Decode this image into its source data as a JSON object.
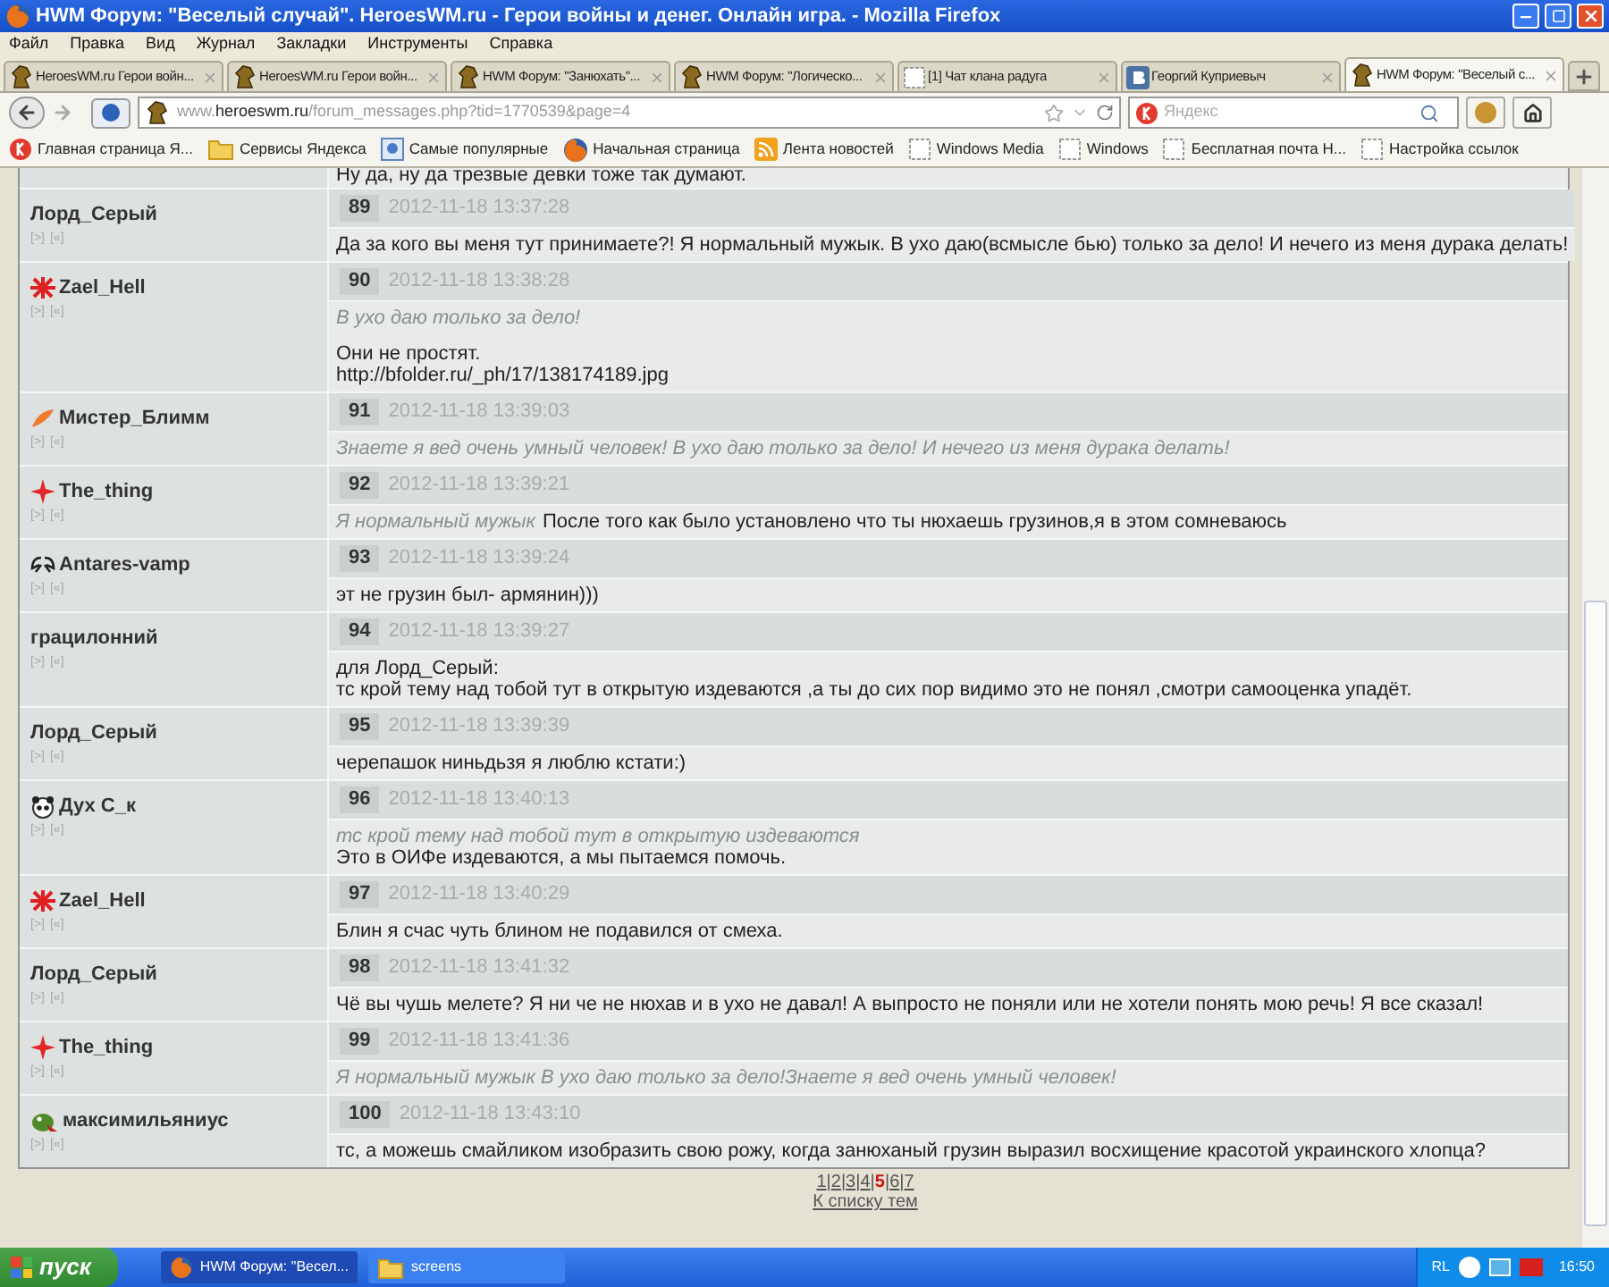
{
  "window": {
    "title": "HWM Форум: \"Веселый случай\". HeroesWM.ru - Герои войны и денег. Онлайн игра. - Mozilla Firefox"
  },
  "menu": [
    "Файл",
    "Правка",
    "Вид",
    "Журнал",
    "Закладки",
    "Инструменты",
    "Справка"
  ],
  "tabs": [
    {
      "label": "HeroesWM.ru Герои войн...",
      "kind": "knight",
      "selected": false
    },
    {
      "label": "HeroesWM.ru Герои войн...",
      "kind": "knight",
      "selected": false
    },
    {
      "label": "HWM Форум: \"Занюхать\"...",
      "kind": "knight",
      "selected": false
    },
    {
      "label": "HWM Форум: \"Логическо...",
      "kind": "knight",
      "selected": false
    },
    {
      "label": "[1] Чат клана радуга",
      "kind": "blank",
      "selected": false
    },
    {
      "label": "Георгий Куприевыч",
      "kind": "vk",
      "selected": false
    },
    {
      "label": "HWM Форум: \"Веселый с...",
      "kind": "knight",
      "selected": true
    }
  ],
  "address": {
    "prefix": "www.",
    "host": "heroeswm.ru",
    "path": "/forum_messages.php?tid=1770539&page=4"
  },
  "search": {
    "placeholder": "Яндекс"
  },
  "bookmarks": [
    {
      "label": "Главная страница Я...",
      "kind": "yandex"
    },
    {
      "label": "Сервисы Яндекса",
      "kind": "folder"
    },
    {
      "label": "Самые популярные",
      "kind": "popular"
    },
    {
      "label": "Начальная страница",
      "kind": "firefox"
    },
    {
      "label": "Лента новостей",
      "kind": "rss"
    },
    {
      "label": "Windows Media",
      "kind": "page"
    },
    {
      "label": "Windows",
      "kind": "page"
    },
    {
      "label": "Бесплатная почта Н...",
      "kind": "page"
    },
    {
      "label": "Настройка ссылок",
      "kind": "page"
    }
  ],
  "partial_text": "Ну да, ну да трезвые девки тоже так думают.",
  "posts": [
    {
      "author": "Лорд_Серый",
      "kind": "none",
      "links": [
        "[>]",
        "[«]"
      ],
      "number": "89",
      "date": "2012-11-18 13:37:28",
      "lines": [
        {
          "kind": "text",
          "text": "Да за кого вы меня тут принимаете?! Я нормальный мужык. В ухо даю(всмысле бью) только за дело! И нечего из меня дурака делать!"
        }
      ]
    },
    {
      "author": "Zael_Hell",
      "kind": "cross",
      "links": [
        "[>]",
        "[«]"
      ],
      "number": "90",
      "date": "2012-11-18 13:38:28",
      "lines": [
        {
          "kind": "quote",
          "text": "В ухо даю только за дело!"
        },
        {
          "kind": "break"
        },
        {
          "kind": "text",
          "text": "Они не простят."
        },
        {
          "kind": "text",
          "text": "http://bfolder.ru/_ph/17/138174189.jpg"
        }
      ]
    },
    {
      "author": "Мистер_Блимм",
      "kind": "feather",
      "links": [
        "[>]",
        "[«]"
      ],
      "number": "91",
      "date": "2012-11-18 13:39:03",
      "lines": [
        {
          "kind": "quote",
          "text": "Знаете я вед очень умный человек! В ухо даю только за дело! И нечего из меня дурака делать!"
        }
      ]
    },
    {
      "author": "The_thing",
      "kind": "star",
      "links": [
        "[>]",
        "[«]"
      ],
      "number": "92",
      "date": "2012-11-18 13:39:21",
      "lines": [
        {
          "kind": "mixed",
          "quote": "Я нормальный мужык",
          "text": "После того как было установлено что ты нюхаешь грузинов,я в этом сомневаюсь"
        }
      ]
    },
    {
      "author": "Antares-vamp",
      "kind": "wings",
      "links": [
        "[>]",
        "[«]"
      ],
      "number": "93",
      "date": "2012-11-18 13:39:24",
      "lines": [
        {
          "kind": "text",
          "text": "эт не грузин был- армянин)))"
        }
      ]
    },
    {
      "author": "грацилонний",
      "kind": "none",
      "links": [
        "[>]",
        "[«]"
      ],
      "number": "94",
      "date": "2012-11-18 13:39:27",
      "lines": [
        {
          "kind": "text",
          "text": "для Лорд_Серый:"
        },
        {
          "kind": "text",
          "text": "тс крой тему над тобой тут в открытую издеваются ,а ты до сих пор видимо это не понял ,смотри самооценка упадёт."
        }
      ]
    },
    {
      "author": "Лорд_Серый",
      "kind": "none",
      "links": [
        "[>]",
        "[«]"
      ],
      "number": "95",
      "date": "2012-11-18 13:39:39",
      "lines": [
        {
          "kind": "text",
          "text": "черепашок ниньдьзя я люблю кстати:)"
        }
      ]
    },
    {
      "author": "Дух С_к",
      "kind": "panda",
      "links": [
        "[>]",
        "[«]"
      ],
      "number": "96",
      "date": "2012-11-18 13:40:13",
      "lines": [
        {
          "kind": "quote",
          "text": "тс крой тему над тобой тут в открытую издеваются"
        },
        {
          "kind": "text",
          "text": "Это в ОИФе издеваются, а мы пытаемся помочь."
        }
      ]
    },
    {
      "author": "Zael_Hell",
      "kind": "cross",
      "links": [
        "[>]",
        "[«]"
      ],
      "number": "97",
      "date": "2012-11-18 13:40:29",
      "lines": [
        {
          "kind": "text",
          "text": "Блин я счас чуть блином не подавился от смеха."
        }
      ]
    },
    {
      "author": "Лорд_Серый",
      "kind": "none",
      "links": [
        "[>]",
        "[«]"
      ],
      "number": "98",
      "date": "2012-11-18 13:41:32",
      "lines": [
        {
          "kind": "text",
          "text": "Чё вы чушь мелете? Я ни че не нюхав и в ухо не давал! А выпросто не поняли или не хотели понять мою речь! Я все сказал!"
        }
      ]
    },
    {
      "author": "The_thing",
      "kind": "star",
      "links": [
        "[>]",
        "[«]"
      ],
      "number": "99",
      "date": "2012-11-18 13:41:36",
      "lines": [
        {
          "kind": "quote",
          "text": "Я нормальный мужык В ухо даю только за дело!Знаете я вед очень умный человек!"
        }
      ]
    },
    {
      "author": "максимильяниус",
      "kind": "creature",
      "links": [
        "[>]",
        "[«]"
      ],
      "number": "100",
      "date": "2012-11-18 13:43:10",
      "lines": [
        {
          "kind": "text",
          "text": "тс, а можешь смайликом изобразить свою рожу, когда занюханый грузин выразил восхищение красотой украинского хлопца?"
        }
      ]
    }
  ],
  "pager": {
    "pages": [
      {
        "label": "1",
        "selected": false
      },
      {
        "label": "2",
        "selected": false
      },
      {
        "label": "3",
        "selected": false
      },
      {
        "label": "4",
        "selected": false
      },
      {
        "label": "5",
        "selected": true
      },
      {
        "label": "6",
        "selected": false
      },
      {
        "label": "7",
        "selected": false
      }
    ],
    "separators": [
      "|",
      "|",
      "|",
      "|",
      "|",
      "|"
    ],
    "back_link": "К списку тем"
  },
  "taskbar": {
    "start": "пуск",
    "tasks": [
      {
        "label": "HWM Форум: \"Весел...",
        "kind": "firefox",
        "selected": true
      },
      {
        "label": "screens",
        "kind": "folder",
        "selected": false
      }
    ],
    "lang": "RL",
    "time": "16:50"
  }
}
